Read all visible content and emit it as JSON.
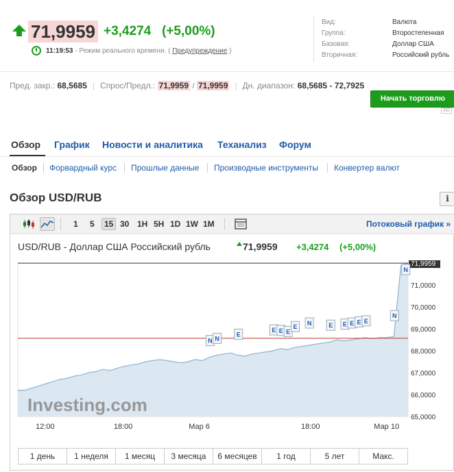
{
  "header": {
    "price": "71,9959",
    "change": "+3,4274",
    "change_pct": "(+5,00%)",
    "time": "11:19:53",
    "realtime_text": " - Режим реального времени. ( ",
    "warning_link": "Предупреждение",
    "realtime_close": " )"
  },
  "info": {
    "rows": [
      {
        "key": "Вид:",
        "value": "Валюта"
      },
      {
        "key": "Группа:",
        "value": "Второстепенная"
      },
      {
        "key": "Базовая:",
        "value": "Доллар США"
      },
      {
        "key": "Вторичная:",
        "value": "Российский рубль"
      }
    ]
  },
  "stats": {
    "prev_close_label": "Пред. закр.:",
    "prev_close": "68,5685",
    "bid_ask_label": "Спрос/Предл.:",
    "bid": "71,9959",
    "ask": "71,9959",
    "day_range_label": "Дн. диапазон:",
    "day_range": "68,5685 - 72,7925"
  },
  "trade_button": "Начать торговлю",
  "ad_mark": "AD",
  "tabs": [
    "Обзор",
    "График",
    "Новости и аналитика",
    "Теханализ",
    "Форум"
  ],
  "subtabs": [
    "Обзор",
    "Форвардный курс",
    "Прошлые данные",
    "Производные инструменты",
    "Конвертер валют"
  ],
  "section_title": "Обзор USD/RUB",
  "info_button": "i",
  "toolbar": {
    "intervals": [
      "1",
      "5",
      "15",
      "30",
      "1H",
      "5H",
      "1D",
      "1W",
      "1M"
    ],
    "selected_interval": "15",
    "stream_link": "Потоковый график »"
  },
  "chart_header": {
    "title": "USD/RUB - Доллар США Российский рубль",
    "price": "71,9959",
    "change": "+3,4274",
    "change_pct": "(+5,00%)"
  },
  "chart_data": {
    "type": "area",
    "x_labels": [
      "12:00",
      "18:00",
      "Мар 6",
      "18:00",
      "Мар 10"
    ],
    "y_ticks": [
      "65,0000",
      "66,0000",
      "67,0000",
      "68,0000",
      "69,0000",
      "70,0000",
      "71,0000"
    ],
    "ylim": [
      65.0,
      72.0
    ],
    "current_price_label": "71,9959",
    "current_price": 71.9959,
    "prev_close_line": 68.5685,
    "values": [
      66.2,
      66.2,
      66.3,
      66.4,
      66.5,
      66.6,
      66.7,
      66.75,
      66.85,
      66.9,
      67.0,
      67.05,
      67.15,
      67.1,
      67.2,
      67.3,
      67.35,
      67.4,
      67.5,
      67.55,
      67.6,
      67.55,
      67.5,
      67.45,
      67.5,
      67.6,
      67.55,
      67.7,
      67.8,
      67.85,
      67.9,
      67.8,
      67.75,
      67.85,
      67.9,
      67.95,
      68.0,
      68.1,
      68.05,
      68.15,
      68.2,
      68.25,
      68.3,
      68.35,
      68.4,
      68.5,
      68.45,
      68.5,
      68.55,
      68.6,
      68.55,
      68.6,
      68.6,
      68.65,
      71.9,
      72.0
    ],
    "events": [
      "N",
      "N",
      "E",
      "E",
      "E",
      "E",
      "E",
      "N",
      "E",
      "E",
      "E",
      "E",
      "E",
      "N",
      "N"
    ],
    "watermark": "Investing.com",
    "colors": {
      "area": "#dbe7f1",
      "line": "#8fb3d3",
      "prev_close": "#c0392b",
      "current": "#333333"
    }
  },
  "ranges": [
    "1 день",
    "1 неделя",
    "1 месяц",
    "3 месяца",
    "6 месяцев",
    "1 год",
    "5 лет",
    "Макс."
  ],
  "colors": {
    "up": "#1b9d1b",
    "link": "#1f5ba8",
    "highlight": "#f7d6d6"
  }
}
